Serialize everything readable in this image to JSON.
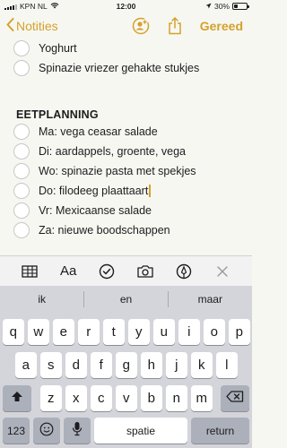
{
  "status": {
    "carrier": "KPN NL",
    "time": "12:00",
    "battery": "30%",
    "battery_level": 0.3
  },
  "nav": {
    "back_label": "Notities",
    "done_label": "Gereed",
    "icons": [
      "chevron-left-icon",
      "add-person-icon",
      "share-icon"
    ]
  },
  "note": {
    "items_top": [
      "Yoghurt",
      "Spinazie vriezer gehakte stukjes"
    ],
    "section_title": "EETPLANNING",
    "items": [
      "Ma: vega ceasar salade",
      "Di: aardappels, groente, vega",
      "Wo: spinazie pasta met spekjes",
      "Do: filodeeg plaattaart",
      "Vr: Mexicaanse salade",
      "Za: nieuwe boodschappen"
    ]
  },
  "toolbar": {
    "format_label": "Aa",
    "icons": [
      "table-icon",
      "format-icon",
      "checklist-icon",
      "camera-icon",
      "markup-icon",
      "close-icon"
    ]
  },
  "suggestions": [
    "ik",
    "en",
    "maar"
  ],
  "keyboard": {
    "row1": [
      "q",
      "w",
      "e",
      "r",
      "t",
      "y",
      "u",
      "i",
      "o",
      "p"
    ],
    "row2": [
      "a",
      "s",
      "d",
      "f",
      "g",
      "h",
      "j",
      "k",
      "l"
    ],
    "row3": [
      "z",
      "x",
      "c",
      "v",
      "b",
      "n",
      "m"
    ],
    "numbers_label": "123",
    "space_label": "spatie",
    "return_label": "return"
  },
  "colors": {
    "accent": "#d4a22a",
    "background": "#f7f7f2",
    "keyboard": "#d4d5da"
  }
}
